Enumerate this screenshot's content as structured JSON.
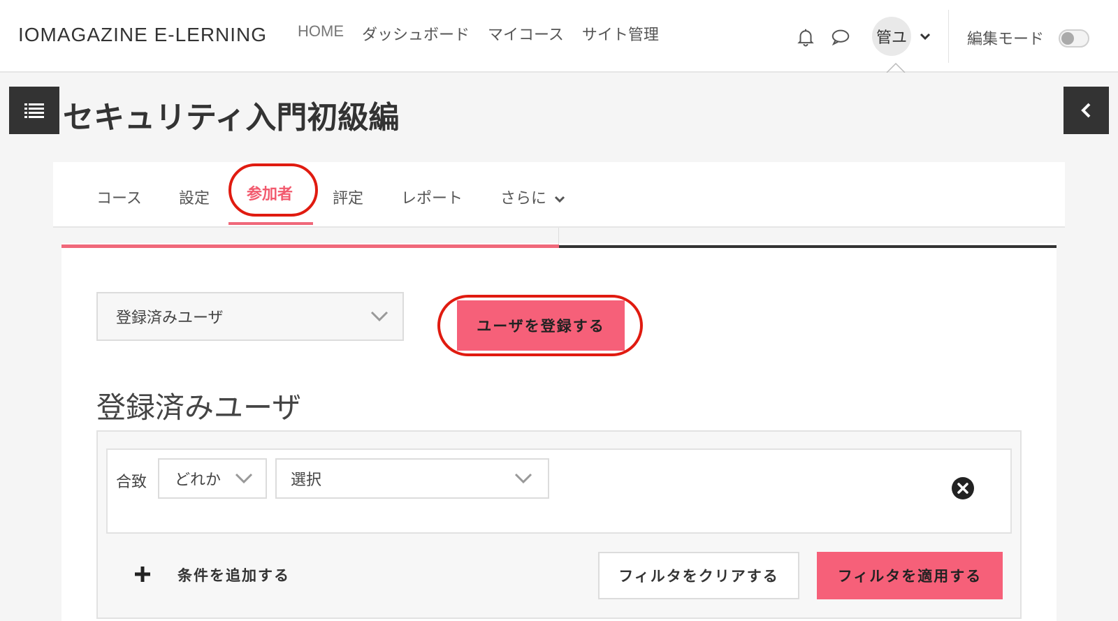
{
  "header": {
    "brand": "IOMAGAZINE E-LERNING",
    "nav": [
      "HOME",
      "ダッシュボード",
      "マイコース",
      "サイト管理"
    ],
    "user_initials": "管ユ",
    "edit_mode_label": "編集モード"
  },
  "course": {
    "title": "セキュリティ入門初級編"
  },
  "tabs": [
    {
      "label": "コース"
    },
    {
      "label": "設定"
    },
    {
      "label": "参加者"
    },
    {
      "label": "評定"
    },
    {
      "label": "レポート"
    },
    {
      "label": "さらに"
    }
  ],
  "participants": {
    "selector_value": "登録済みユーザ",
    "enrol_button": "ユーザを登録する",
    "heading": "登録済みユーザ"
  },
  "filter": {
    "match_label": "合致",
    "match_value": "どれか",
    "choose_value": "選択",
    "add_condition": "条件を追加する",
    "clear_button": "フィルタをクリアする",
    "apply_button": "フィルタを適用する"
  },
  "colors": {
    "accent": "#f66079",
    "highlight_circle": "#e01b10",
    "dark": "#333333"
  }
}
